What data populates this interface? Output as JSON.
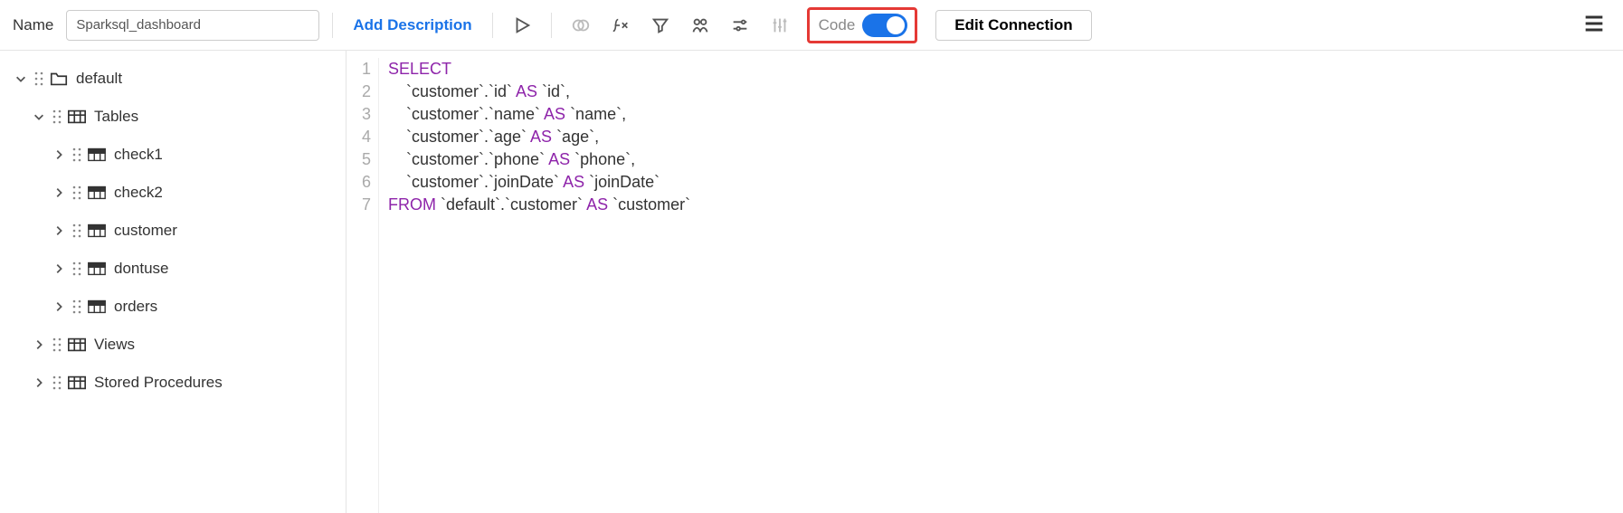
{
  "toolbar": {
    "name_label": "Name",
    "name_value": "Sparksql_dashboard",
    "add_description": "Add Description",
    "code_label": "Code",
    "code_toggle_on": true,
    "edit_connection": "Edit Connection"
  },
  "tree": {
    "root_label": "default",
    "tables_label": "Tables",
    "tables": [
      "check1",
      "check2",
      "customer",
      "dontuse",
      "orders"
    ],
    "views_label": "Views",
    "sp_label": "Stored Procedures"
  },
  "sql": {
    "lines": [
      {
        "n": "1",
        "tokens": [
          {
            "t": "SELECT",
            "c": "kw"
          }
        ]
      },
      {
        "n": "2",
        "tokens": [
          {
            "t": "    `customer`.`id` ",
            "c": "s-ident"
          },
          {
            "t": "AS",
            "c": "kw"
          },
          {
            "t": " `id`,",
            "c": "s-ident"
          }
        ]
      },
      {
        "n": "3",
        "tokens": [
          {
            "t": "    `customer`.`name` ",
            "c": "s-ident"
          },
          {
            "t": "AS",
            "c": "kw"
          },
          {
            "t": " `name`,",
            "c": "s-ident"
          }
        ]
      },
      {
        "n": "4",
        "tokens": [
          {
            "t": "    `customer`.`age` ",
            "c": "s-ident"
          },
          {
            "t": "AS",
            "c": "kw"
          },
          {
            "t": " `age`,",
            "c": "s-ident"
          }
        ]
      },
      {
        "n": "5",
        "tokens": [
          {
            "t": "    `customer`.`phone` ",
            "c": "s-ident"
          },
          {
            "t": "AS",
            "c": "kw"
          },
          {
            "t": " `phone`,",
            "c": "s-ident"
          }
        ]
      },
      {
        "n": "6",
        "tokens": [
          {
            "t": "    `customer`.`joinDate` ",
            "c": "s-ident"
          },
          {
            "t": "AS",
            "c": "kw"
          },
          {
            "t": " `joinDate`",
            "c": "s-ident"
          }
        ]
      },
      {
        "n": "7",
        "tokens": [
          {
            "t": "FROM",
            "c": "kw"
          },
          {
            "t": " `default`.`customer` ",
            "c": "s-ident"
          },
          {
            "t": "AS",
            "c": "kw"
          },
          {
            "t": " `customer`",
            "c": "s-ident"
          }
        ]
      }
    ]
  }
}
